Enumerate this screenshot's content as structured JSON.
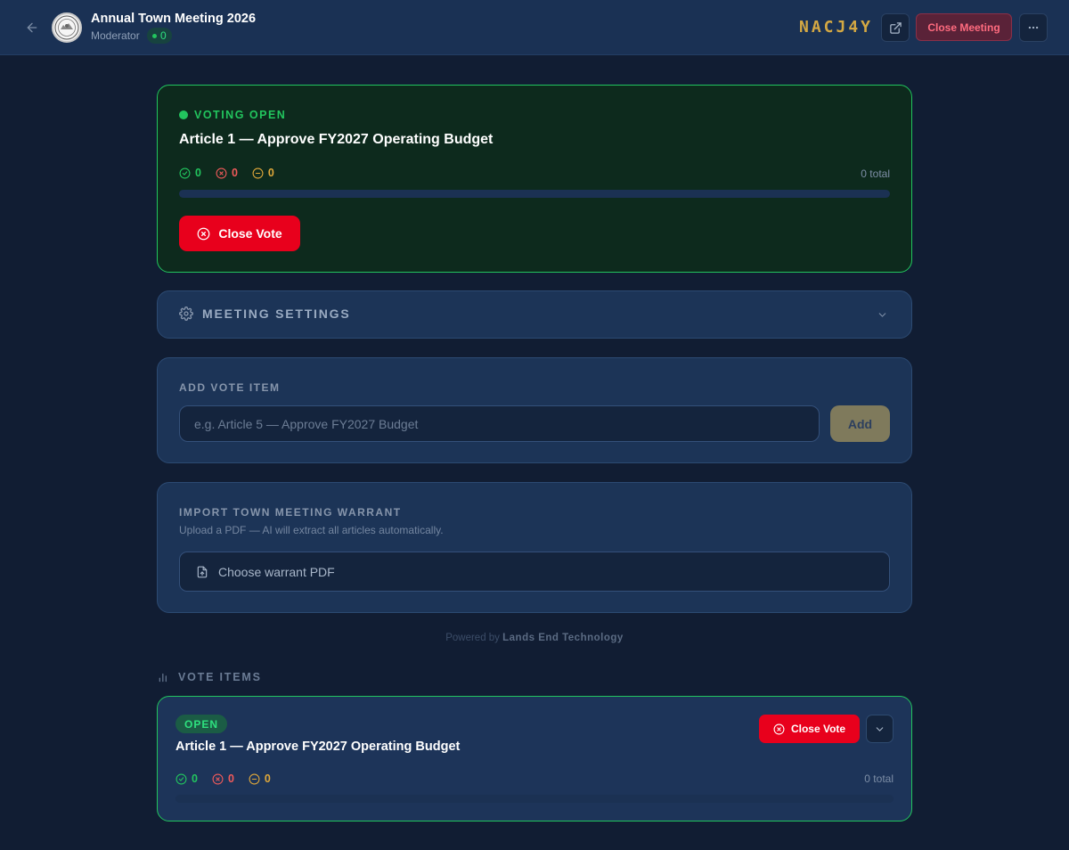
{
  "header": {
    "back_icon": "arrow-left-icon",
    "title": "Annual Town Meeting 2026",
    "role": "Moderator",
    "participant_count": "0",
    "meeting_code": "NACJ4Y",
    "open_external_icon": "external-link-icon",
    "close_meeting_label": "Close Meeting",
    "more_icon": "more-horizontal-icon"
  },
  "active_vote": {
    "status": "VOTING OPEN",
    "title": "Article 1 — Approve FY2027 Operating Budget",
    "yes": "0",
    "no": "0",
    "abstain": "0",
    "total": "0 total",
    "progress": 0,
    "close_label": "Close Vote"
  },
  "settings": {
    "label": "MEETING SETTINGS",
    "icon": "gear-icon",
    "chevron": "chevron-down-icon"
  },
  "add_item": {
    "label": "ADD VOTE ITEM",
    "placeholder": "e.g. Article 5 — Approve FY2027 Budget",
    "value": "",
    "button_label": "Add"
  },
  "import": {
    "label": "IMPORT TOWN MEETING WARRANT",
    "hint": "Upload a PDF — AI will extract all articles automatically.",
    "button_label": "Choose warrant PDF",
    "icon": "file-upload-icon"
  },
  "footer": {
    "powered_prefix": "Powered by",
    "brand": "Lands End Technology"
  },
  "vote_items": {
    "label": "VOTE ITEMS",
    "icon": "bar-chart-icon",
    "items": [
      {
        "status": "OPEN",
        "title": "Article 1 — Approve FY2027 Operating Budget",
        "yes": "0",
        "no": "0",
        "abstain": "0",
        "total": "0 total",
        "progress": 0,
        "close_label": "Close Vote"
      }
    ]
  },
  "colors": {
    "accent_green": "#22c55e",
    "danger_red": "#e8001c",
    "code_gold": "#d4a843",
    "background": "#111d33",
    "card": "#1c3457"
  }
}
